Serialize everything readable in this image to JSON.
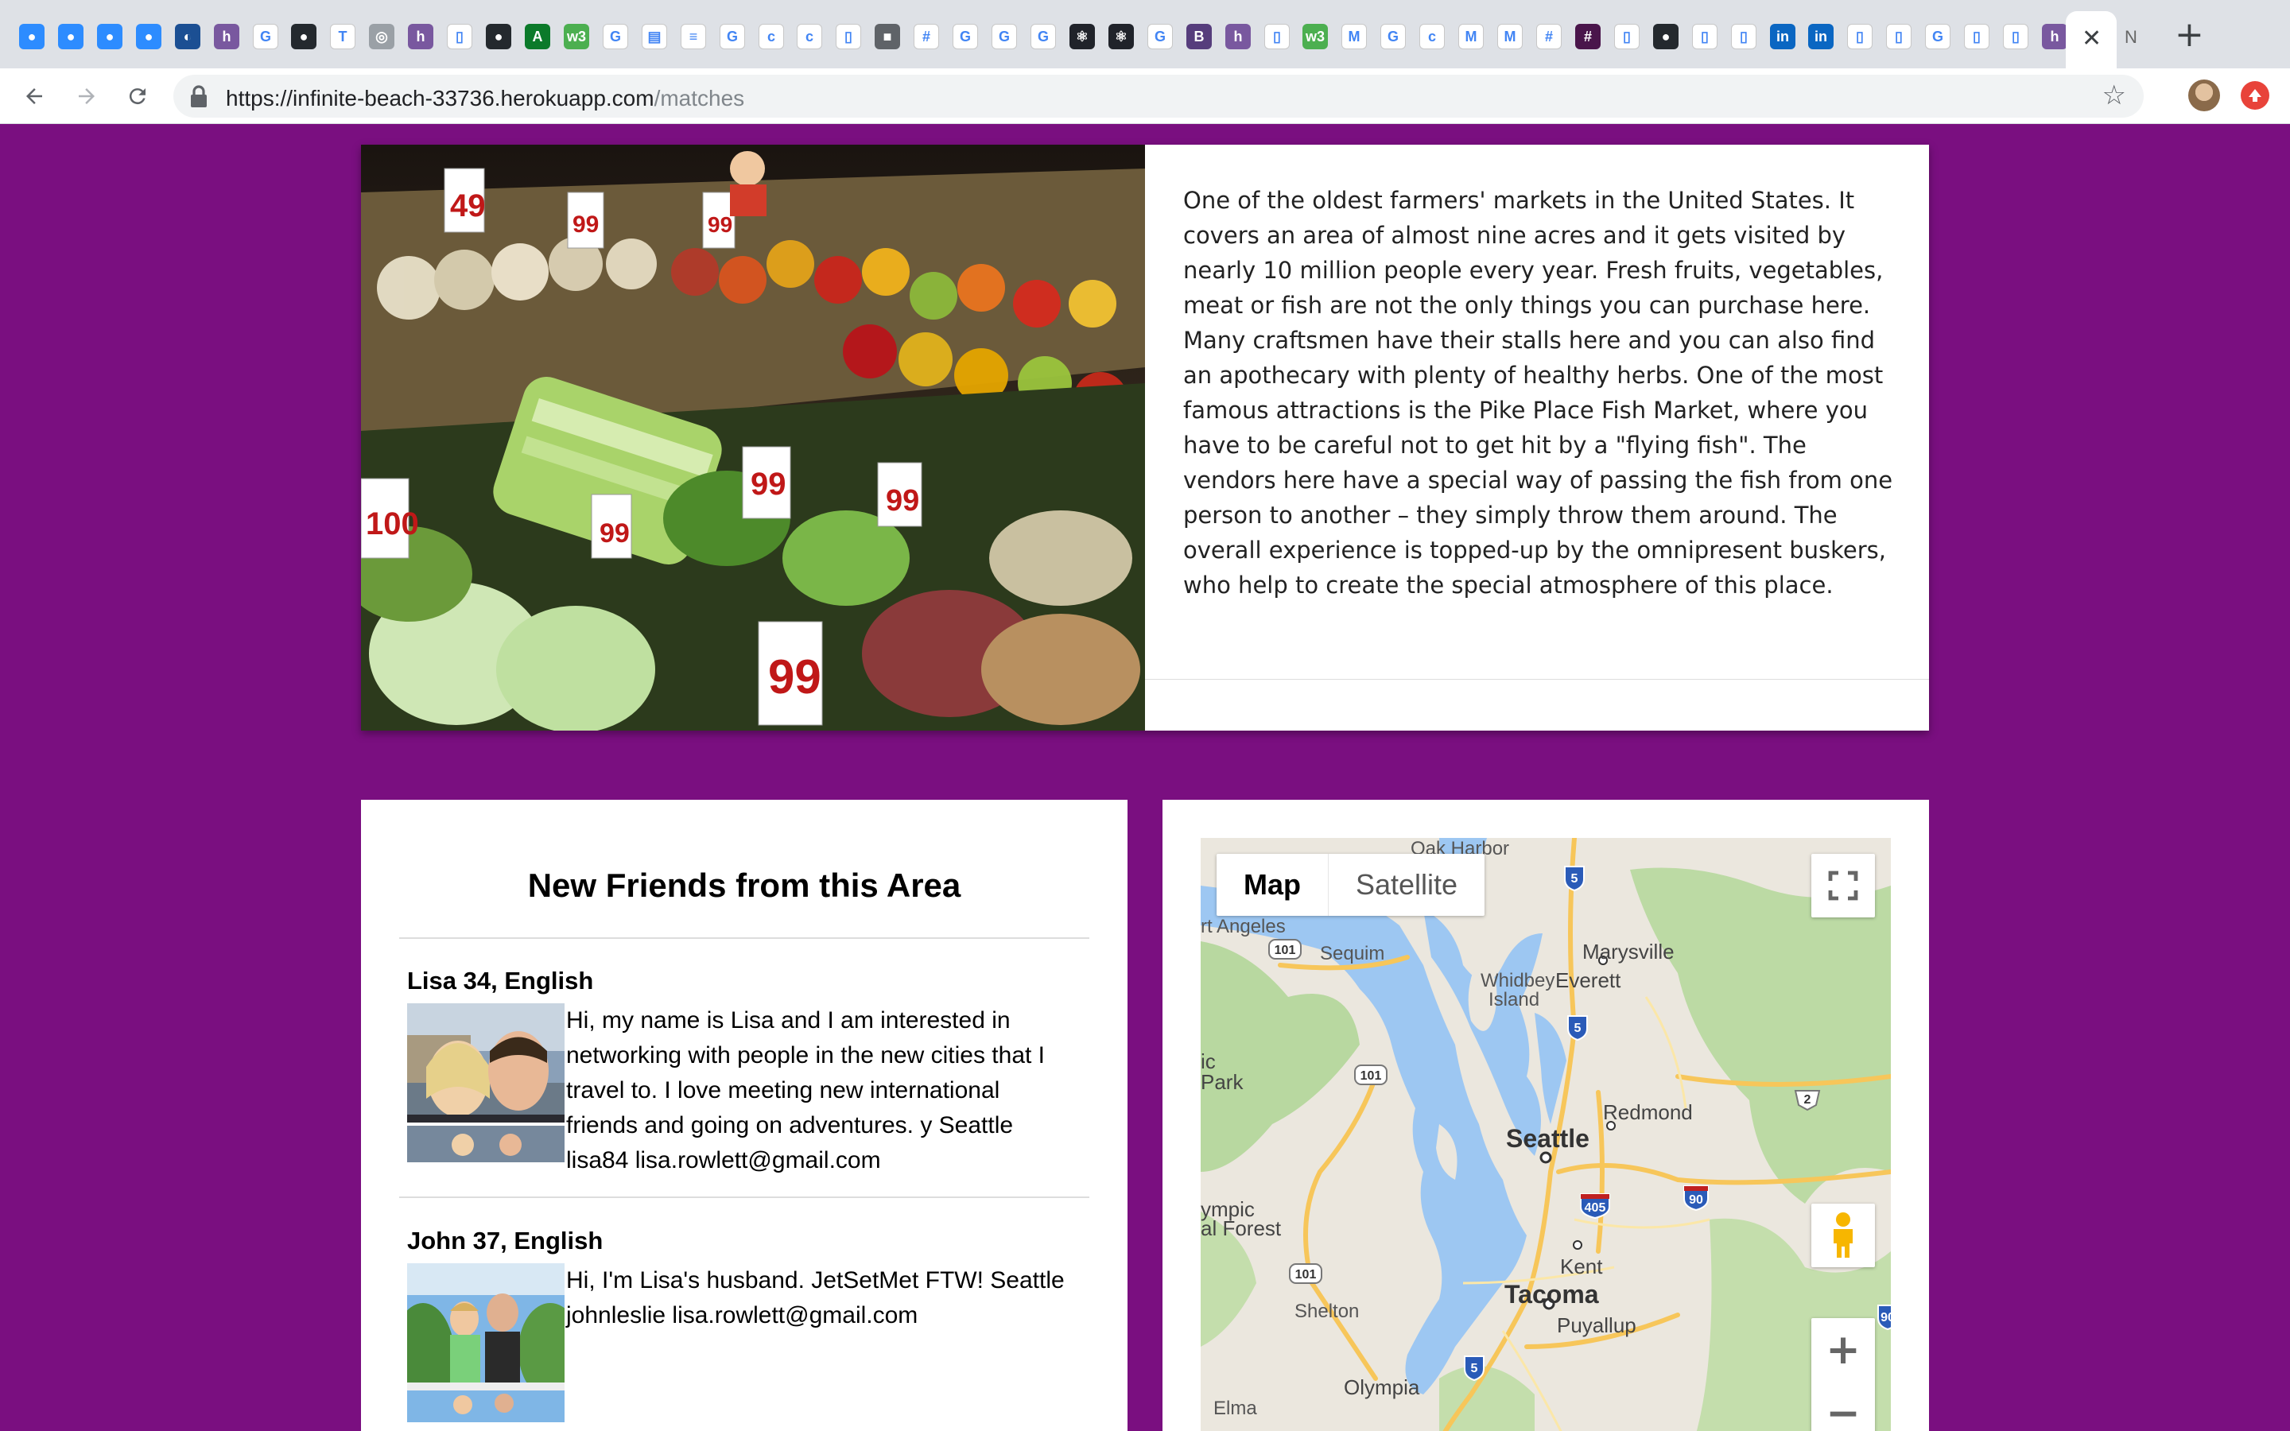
{
  "browser": {
    "tab_icons": [
      {
        "icon": "zoom-icon",
        "color": "#2d8cff",
        "glyph": "●"
      },
      {
        "icon": "zoom-icon",
        "color": "#2d8cff",
        "glyph": "●"
      },
      {
        "icon": "zoom-icon",
        "color": "#2d8cff",
        "glyph": "●"
      },
      {
        "icon": "zoom-icon",
        "color": "#2d8cff",
        "glyph": "●"
      },
      {
        "icon": "browserstack-icon",
        "color": "#1b4f93",
        "glyph": "◐"
      },
      {
        "icon": "heroku-icon",
        "color": "#79589f",
        "glyph": "h"
      },
      {
        "icon": "google-icon",
        "color": "#ffffff",
        "glyph": "G"
      },
      {
        "icon": "github-icon",
        "color": "#24292e",
        "glyph": "●"
      },
      {
        "icon": "nyt-icon",
        "color": "#ffffff",
        "glyph": "T"
      },
      {
        "icon": "circle-icon",
        "color": "#9aa0a6",
        "glyph": "◎"
      },
      {
        "icon": "heroku-icon",
        "color": "#79589f",
        "glyph": "h"
      },
      {
        "icon": "doc-icon",
        "color": "#ffffff",
        "glyph": "▯"
      },
      {
        "icon": "github-icon",
        "color": "#24292e",
        "glyph": "●"
      },
      {
        "icon": "atcoder-icon",
        "color": "#0b7a2a",
        "glyph": "A"
      },
      {
        "icon": "w3-icon",
        "color": "#4caf50",
        "glyph": "w3"
      },
      {
        "icon": "google-icon",
        "color": "#ffffff",
        "glyph": "G"
      },
      {
        "icon": "table-icon",
        "color": "#ffffff",
        "glyph": "▤"
      },
      {
        "icon": "stackoverflow-icon",
        "color": "#ffffff",
        "glyph": "≡"
      },
      {
        "icon": "google-icon",
        "color": "#ffffff",
        "glyph": "G"
      },
      {
        "icon": "doc-icon",
        "color": "#ffffff",
        "glyph": "c"
      },
      {
        "icon": "doc-icon",
        "color": "#ffffff",
        "glyph": "c"
      },
      {
        "icon": "doc-icon",
        "color": "#ffffff",
        "glyph": "▯"
      },
      {
        "icon": "folder-icon",
        "color": "#5f6368",
        "glyph": "■"
      },
      {
        "icon": "slack-icon",
        "color": "#ffffff",
        "glyph": "#"
      },
      {
        "icon": "google-icon",
        "color": "#ffffff",
        "glyph": "G"
      },
      {
        "icon": "google-icon",
        "color": "#ffffff",
        "glyph": "G"
      },
      {
        "icon": "google-icon",
        "color": "#ffffff",
        "glyph": "G"
      },
      {
        "icon": "react-icon",
        "color": "#20232a",
        "glyph": "⚛"
      },
      {
        "icon": "react-icon",
        "color": "#20232a",
        "glyph": "⚛"
      },
      {
        "icon": "google-icon",
        "color": "#ffffff",
        "glyph": "G"
      },
      {
        "icon": "bootstrap-icon",
        "color": "#563d7c",
        "glyph": "B"
      },
      {
        "icon": "heroku-icon",
        "color": "#79589f",
        "glyph": "h"
      },
      {
        "icon": "doc-icon",
        "color": "#ffffff",
        "glyph": "▯"
      },
      {
        "icon": "w3-icon",
        "color": "#4caf50",
        "glyph": "w3"
      },
      {
        "icon": "gmail-icon",
        "color": "#ffffff",
        "glyph": "M"
      },
      {
        "icon": "google-icon",
        "color": "#ffffff",
        "glyph": "G"
      },
      {
        "icon": "doc-icon",
        "color": "#ffffff",
        "glyph": "c"
      },
      {
        "icon": "gmail-icon",
        "color": "#ffffff",
        "glyph": "M"
      },
      {
        "icon": "gmail-icon",
        "color": "#ffffff",
        "glyph": "M"
      },
      {
        "icon": "slack-icon",
        "color": "#ffffff",
        "glyph": "#"
      },
      {
        "icon": "slack-icon",
        "color": "#4a154b",
        "glyph": "#"
      },
      {
        "icon": "doc-icon",
        "color": "#ffffff",
        "glyph": "▯"
      },
      {
        "icon": "github-icon",
        "color": "#24292e",
        "glyph": "●"
      },
      {
        "icon": "doc-icon",
        "color": "#ffffff",
        "glyph": "▯"
      },
      {
        "icon": "doc-icon",
        "color": "#ffffff",
        "glyph": "▯"
      },
      {
        "icon": "linkedin-icon",
        "color": "#0a66c2",
        "glyph": "in"
      },
      {
        "icon": "linkedin-icon",
        "color": "#0a66c2",
        "glyph": "in"
      },
      {
        "icon": "doc-icon",
        "color": "#ffffff",
        "glyph": "▯"
      },
      {
        "icon": "doc-icon",
        "color": "#ffffff",
        "glyph": "▯"
      },
      {
        "icon": "google-icon",
        "color": "#ffffff",
        "glyph": "G"
      },
      {
        "icon": "doc-icon",
        "color": "#ffffff",
        "glyph": "▯"
      },
      {
        "icon": "doc-icon",
        "color": "#ffffff",
        "glyph": "▯"
      },
      {
        "icon": "heroku-icon",
        "color": "#79589f",
        "glyph": "h"
      }
    ],
    "active_tab_close": "✕",
    "next_tab_label": "N",
    "new_tab": "+",
    "url_host": "https://infinite-beach-33736.herokuapp.com",
    "url_path": "/matches",
    "star": "☆"
  },
  "place": {
    "description": "One of the oldest farmers' markets in the United States. It covers an area of almost nine acres and it gets visited by nearly 10 million people every year. Fresh fruits, vegetables, meat or fish are not the only things you can purchase here. Many craftsmen have their stalls here and you can also find an apothecary with plenty of healthy herbs. One of the most famous attractions is the Pike Place Fish Market, where you have to be careful not to get hit by a \"flying fish\". The vendors here have a special way of passing the fish from one person to another – they simply throw them around. The overall experience is topped-up by the omnipresent buskers, who help to create the special atmosphere of this place."
  },
  "friends": {
    "title": "New Friends from this Area",
    "items": [
      {
        "name": "Lisa 34, English",
        "text": "Hi, my name is Lisa and I am interested in networking with people in the new cities that I travel to. I love meeting new international friends and going on adventures. y Seattle lisa84 lisa.rowlett@gmail.com"
      },
      {
        "name": "John 37, English",
        "text": "Hi, I'm Lisa's husband. JetSetMet FTW! Seattle johnleslie lisa.rowlett@gmail.com"
      }
    ]
  },
  "map": {
    "type_map": "Map",
    "type_satellite": "Satellite",
    "zoom_in": "+",
    "zoom_out": "−",
    "labels": {
      "oak_harbor": "Oak Harbor",
      "port_angeles": "rt Angeles",
      "sequim": "Sequim",
      "marysville": "Marysville",
      "whidbey": "Whidbey",
      "island": "Island",
      "everett": "Everett",
      "ic": "ic",
      "park": "Park",
      "redmond": "Redmond",
      "seattle": "Seattle",
      "olympic": "ympic",
      "forest": "al Forest",
      "kent": "Kent",
      "tacoma": "Tacoma",
      "shelton": "Shelton",
      "puyallup": "Puyallup",
      "olympia": "Olympia",
      "elma": "Elma"
    },
    "shields": [
      "5",
      "5",
      "101",
      "101",
      "2",
      "405",
      "90",
      "101",
      "5",
      "90"
    ]
  }
}
